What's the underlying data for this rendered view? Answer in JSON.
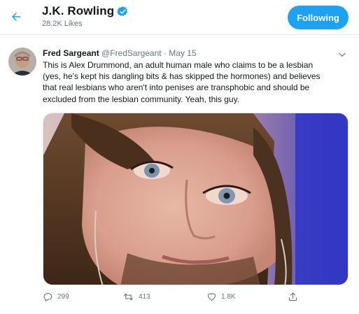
{
  "header": {
    "title": "J.K. Rowling",
    "likes": "28.2K Likes",
    "follow_label": "Following"
  },
  "tweet": {
    "author_name": "Fred Sargeant",
    "handle": "@FredSargeant",
    "separator": "·",
    "date": "May 15",
    "lines": [
      "This is Alex Drummond, an adult human male who claims to be a lesbian",
      "(yes, he's kept his dangling bits & has skipped the hormones) and believes",
      "that real lesbians who aren't into penises are transphobic and should be",
      "excluded from the lesbian community.  Yeah, this guy."
    ],
    "actions": {
      "replies": "299",
      "retweets": "413",
      "likes": "1.8K"
    }
  },
  "icons": {
    "back": "arrow-left-icon",
    "verified": "verified-badge-icon",
    "more": "chevron-down-icon",
    "reply": "reply-icon",
    "retweet": "retweet-icon",
    "like": "heart-icon",
    "share": "share-icon"
  },
  "colors": {
    "accent": "#1da1f2",
    "muted": "#657786",
    "text": "#14171a"
  }
}
